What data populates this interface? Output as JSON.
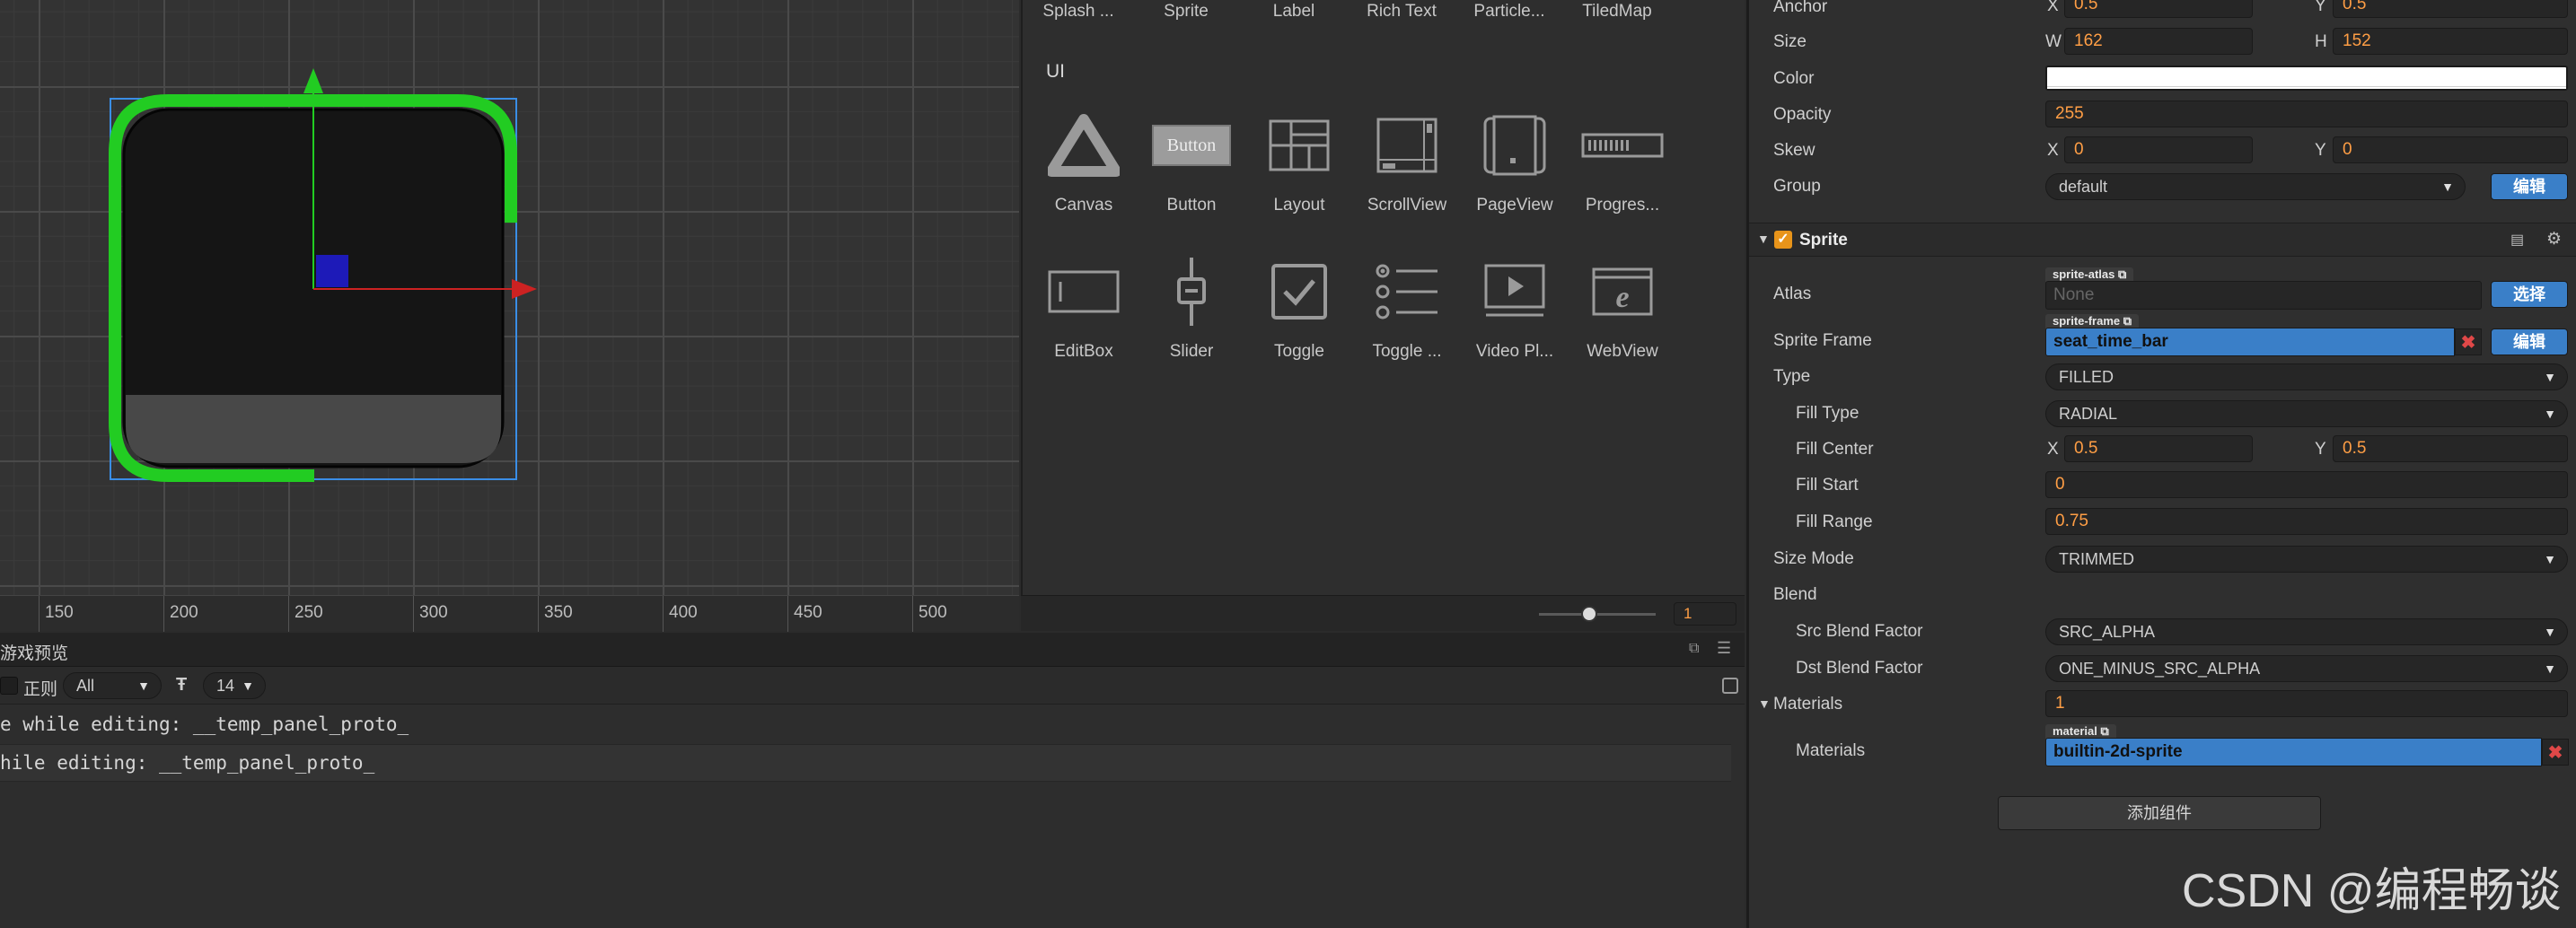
{
  "scene": {
    "ruler_ticks": [
      "150",
      "200",
      "250",
      "300",
      "350",
      "400",
      "450",
      "500"
    ]
  },
  "assets": {
    "top_row": [
      "Splash ...",
      "Sprite",
      "Label",
      "Rich Text",
      "Particle...",
      "TiledMap"
    ],
    "section_title": "UI",
    "ui_items": [
      {
        "label": "Canvas",
        "icon": "canvas-triangle-icon"
      },
      {
        "label": "Button",
        "icon": "button-icon",
        "icon_text": "Button"
      },
      {
        "label": "Layout",
        "icon": "layout-grid-icon"
      },
      {
        "label": "ScrollView",
        "icon": "scrollview-icon"
      },
      {
        "label": "PageView",
        "icon": "pageview-icon"
      },
      {
        "label": "Progres...",
        "icon": "progressbar-icon"
      },
      {
        "label": "EditBox",
        "icon": "editbox-icon"
      },
      {
        "label": "Slider",
        "icon": "slider-icon"
      },
      {
        "label": "Toggle",
        "icon": "checkbox-icon"
      },
      {
        "label": "Toggle ...",
        "icon": "toggle-group-icon"
      },
      {
        "label": "Video Pl...",
        "icon": "video-player-icon"
      },
      {
        "label": "WebView",
        "icon": "webview-icon"
      }
    ],
    "zoom_value": "1"
  },
  "console": {
    "tab_label": "游戏预览",
    "regex_label": "正则",
    "filter_value": "All",
    "font_size_value": "14",
    "logs": [
      "e while editing: __temp_panel_proto_",
      "hile editing: __temp_panel_proto_"
    ]
  },
  "inspector": {
    "anchor": {
      "label": "Anchor",
      "x": "0.5",
      "y": "0.5"
    },
    "size": {
      "label": "Size",
      "w_label": "W",
      "w": "162",
      "h_label": "H",
      "h": "152"
    },
    "color": {
      "label": "Color",
      "value": "#ffffff"
    },
    "opacity": {
      "label": "Opacity",
      "value": "255"
    },
    "skew": {
      "label": "Skew",
      "x": "0",
      "y": "0"
    },
    "group": {
      "label": "Group",
      "value": "default",
      "button": "编辑"
    },
    "sprite_header": "Sprite",
    "atlas": {
      "label": "Atlas",
      "tag": "sprite-atlas",
      "value": "None",
      "button": "选择"
    },
    "sprite_frame": {
      "label": "Sprite Frame",
      "tag": "sprite-frame",
      "value": "seat_time_bar",
      "button": "编辑"
    },
    "type": {
      "label": "Type",
      "value": "FILLED"
    },
    "fill_type": {
      "label": "Fill Type",
      "value": "RADIAL"
    },
    "fill_center": {
      "label": "Fill Center",
      "x": "0.5",
      "y": "0.5"
    },
    "fill_start": {
      "label": "Fill Start",
      "value": "0"
    },
    "fill_range": {
      "label": "Fill Range",
      "value": "0.75"
    },
    "size_mode": {
      "label": "Size Mode",
      "value": "TRIMMED"
    },
    "blend": {
      "label": "Blend"
    },
    "src_blend": {
      "label": "Src Blend Factor",
      "value": "SRC_ALPHA"
    },
    "dst_blend": {
      "label": "Dst Blend Factor",
      "value": "ONE_MINUS_SRC_ALPHA"
    },
    "materials_count": {
      "label": "Materials",
      "value": "1"
    },
    "materials": {
      "label": "Materials",
      "tag": "material",
      "value": "builtin-2d-sprite"
    },
    "add_component": "添加组件",
    "axis_x": "X",
    "axis_y": "Y"
  },
  "watermark": "CSDN @编程畅谈",
  "colors": {
    "accent_blue": "#3a7fc8",
    "orange_value": "#ff9e45",
    "gizmo_green": "#1ed11e",
    "gizmo_red": "#d11f1f"
  }
}
